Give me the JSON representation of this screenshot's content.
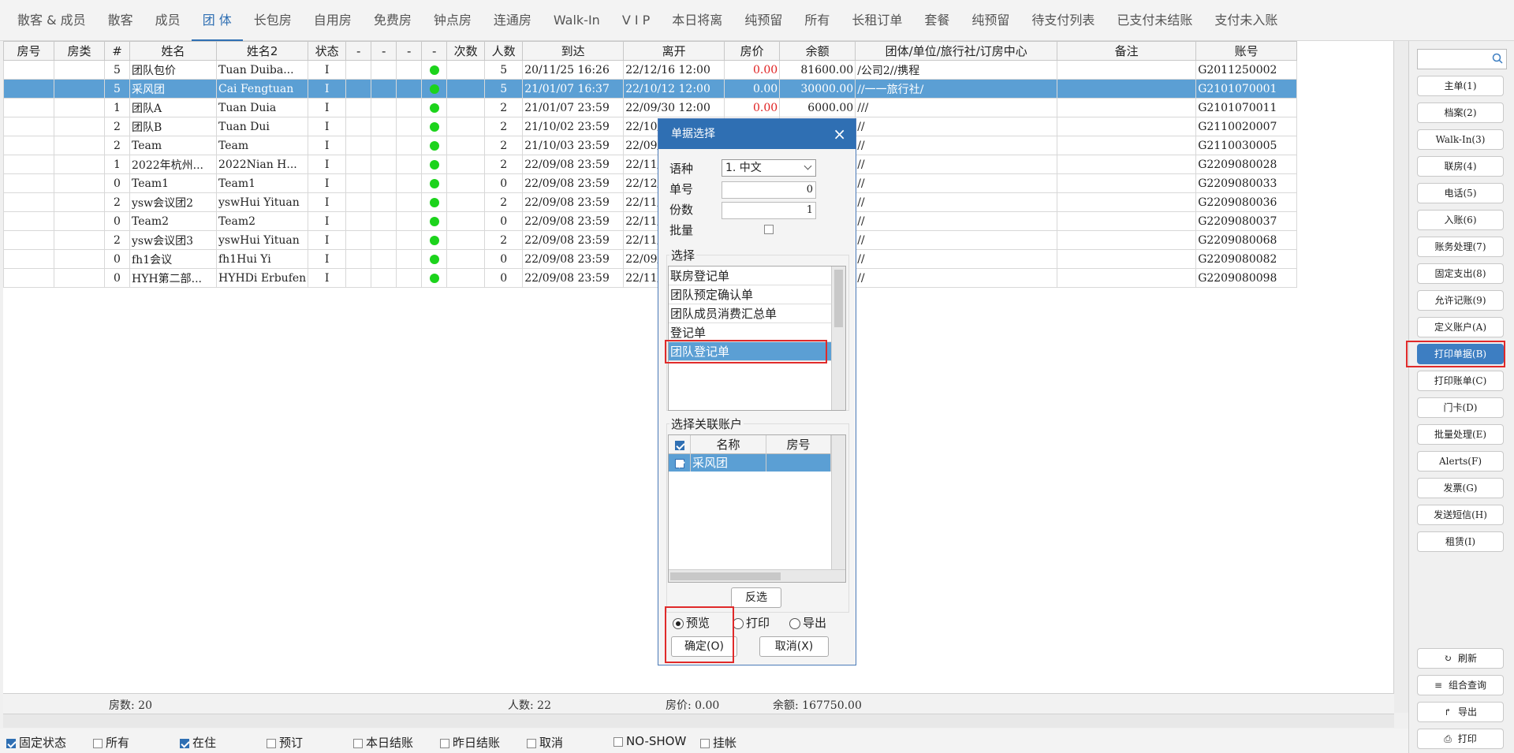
{
  "tabs": [
    {
      "label": "散客 & 成员",
      "active": false
    },
    {
      "label": "散客",
      "active": false
    },
    {
      "label": "成员",
      "active": false
    },
    {
      "label": "团 体",
      "active": true
    },
    {
      "label": "长包房",
      "active": false
    },
    {
      "label": "自用房",
      "active": false
    },
    {
      "label": "免费房",
      "active": false
    },
    {
      "label": "钟点房",
      "active": false
    },
    {
      "label": "连通房",
      "active": false
    },
    {
      "label": "Walk-In",
      "active": false
    },
    {
      "label": "V I P",
      "active": false
    },
    {
      "label": "本日将离",
      "active": false
    },
    {
      "label": "纯预留",
      "active": false
    },
    {
      "label": "所有",
      "active": false
    },
    {
      "label": "长租订单",
      "active": false
    },
    {
      "label": "套餐",
      "active": false
    },
    {
      "label": "纯预留",
      "active": false
    },
    {
      "label": "待支付列表",
      "active": false
    },
    {
      "label": "已支付未结账",
      "active": false
    },
    {
      "label": "支付未入账",
      "active": false
    }
  ],
  "grid": {
    "columns": [
      "房号",
      "房类",
      "#",
      "姓名",
      "姓名2",
      "状态",
      "-",
      "-",
      "-",
      "-",
      "次数",
      "人数",
      "到达",
      "离开",
      "房价",
      "余额",
      "团体/单位/旅行社/订房中心",
      "备注",
      "账号"
    ],
    "rows": [
      {
        "room": "",
        "type": "",
        "num": "5",
        "name": "团队包价",
        "name2": "Tuan Duiba...",
        "status": "I",
        "count": "",
        "persons": "5",
        "arrive": "20/11/25 16:26",
        "depart": "22/12/16 12:00",
        "price": "0.00",
        "balance": "81600.00",
        "group": "/公司2//携程",
        "remark": "",
        "account": "G2011250002",
        "selected": false
      },
      {
        "room": "",
        "type": "",
        "num": "5",
        "name": "采风团",
        "name2": "Cai Fengtuan",
        "status": "I",
        "count": "",
        "persons": "5",
        "arrive": "21/01/07 16:37",
        "depart": "22/10/12 12:00",
        "price": "0.00",
        "balance": "30000.00",
        "group": "//一一旅行社/",
        "remark": "",
        "account": "G2101070001",
        "selected": true
      },
      {
        "room": "",
        "type": "",
        "num": "1",
        "name": "团队A",
        "name2": "Tuan Duia",
        "status": "I",
        "count": "",
        "persons": "2",
        "arrive": "21/01/07 23:59",
        "depart": "22/09/30 12:00",
        "price": "0.00",
        "balance": "6000.00",
        "group": "///",
        "remark": "",
        "account": "G2101070011",
        "selected": false
      },
      {
        "room": "",
        "type": "",
        "num": "2",
        "name": "团队B",
        "name2": "Tuan Dui",
        "status": "I",
        "count": "",
        "persons": "2",
        "arrive": "21/10/02 23:59",
        "depart": "22/10/",
        "price": "",
        "balance": "",
        "group": "//",
        "remark": "",
        "account": "G2110020007",
        "selected": false
      },
      {
        "room": "",
        "type": "",
        "num": "2",
        "name": "Team",
        "name2": "Team",
        "status": "I",
        "count": "",
        "persons": "2",
        "arrive": "21/10/03 23:59",
        "depart": "22/09/",
        "price": "",
        "balance": "",
        "group": "//",
        "remark": "",
        "account": "G2110030005",
        "selected": false
      },
      {
        "room": "",
        "type": "",
        "num": "1",
        "name": "2022年杭州...",
        "name2": "2022Nian H...",
        "status": "I",
        "count": "",
        "persons": "2",
        "arrive": "22/09/08 23:59",
        "depart": "22/11/",
        "price": "",
        "balance": "",
        "group": "//",
        "remark": "",
        "account": "G2209080028",
        "selected": false
      },
      {
        "room": "",
        "type": "",
        "num": "0",
        "name": "Team1",
        "name2": "Team1",
        "status": "I",
        "count": "",
        "persons": "0",
        "arrive": "22/09/08 23:59",
        "depart": "22/12/",
        "price": "",
        "balance": "",
        "group": "//",
        "remark": "",
        "account": "G2209080033",
        "selected": false
      },
      {
        "room": "",
        "type": "",
        "num": "2",
        "name": "ysw会议团2",
        "name2": "yswHui Yituan",
        "status": "I",
        "count": "",
        "persons": "2",
        "arrive": "22/09/08 23:59",
        "depart": "22/11/",
        "price": "",
        "balance": "",
        "group": "//",
        "remark": "",
        "account": "G2209080036",
        "selected": false
      },
      {
        "room": "",
        "type": "",
        "num": "0",
        "name": "Team2",
        "name2": "Team2",
        "status": "I",
        "count": "",
        "persons": "0",
        "arrive": "22/09/08 23:59",
        "depart": "22/11/",
        "price": "",
        "balance": "",
        "group": "//",
        "remark": "",
        "account": "G2209080037",
        "selected": false
      },
      {
        "room": "",
        "type": "",
        "num": "2",
        "name": "ysw会议团3",
        "name2": "yswHui Yituan",
        "status": "I",
        "count": "",
        "persons": "2",
        "arrive": "22/09/08 23:59",
        "depart": "22/11/",
        "price": "",
        "balance": "",
        "group": "//",
        "remark": "",
        "account": "G2209080068",
        "selected": false
      },
      {
        "room": "",
        "type": "",
        "num": "0",
        "name": "fh1会议",
        "name2": "fh1Hui Yi",
        "status": "I",
        "count": "",
        "persons": "0",
        "arrive": "22/09/08 23:59",
        "depart": "22/09/",
        "price": "",
        "balance": "",
        "group": "//",
        "remark": "",
        "account": "G2209080082",
        "selected": false
      },
      {
        "room": "",
        "type": "",
        "num": "0",
        "name": "HYH第二部...",
        "name2": "HYHDi Erbufen",
        "status": "I",
        "count": "",
        "persons": "0",
        "arrive": "22/09/08 23:59",
        "depart": "22/11/",
        "price": "",
        "balance": "",
        "group": "//",
        "remark": "",
        "account": "G2209080098",
        "selected": false
      }
    ],
    "status_dot_color": "#1cd31c",
    "selected_color": "#5b9fd4"
  },
  "summary": {
    "rooms": "房数: 20",
    "persons": "人数: 22",
    "price": "房价: 0.00",
    "balance": "余额: 167750.00"
  },
  "footer": {
    "items": [
      {
        "label": "固定状态",
        "checked": true
      },
      {
        "label": "所有",
        "checked": false
      },
      {
        "label": "在住",
        "checked": true
      },
      {
        "label": "预订",
        "checked": false
      },
      {
        "label": "本日结账",
        "checked": false
      },
      {
        "label": "昨日结账",
        "checked": false
      },
      {
        "label": "取消",
        "checked": false
      },
      {
        "label": "NO-SHOW",
        "checked": false
      },
      {
        "label": "挂帐",
        "checked": false
      }
    ]
  },
  "sidebar": {
    "search_icon": "search-icon",
    "buttons": [
      {
        "label": "主单(1)",
        "active": false
      },
      {
        "label": "档案(2)",
        "active": false
      },
      {
        "label": "Walk-In(3)",
        "active": false
      },
      {
        "label": "联房(4)",
        "active": false
      },
      {
        "label": "电话(5)",
        "active": false
      },
      {
        "label": "入账(6)",
        "active": false
      },
      {
        "label": "账务处理(7)",
        "active": false
      },
      {
        "label": "固定支出(8)",
        "active": false
      },
      {
        "label": "允许记账(9)",
        "active": false
      },
      {
        "label": "定义账户(A)",
        "active": false
      },
      {
        "label": "打印单据(B)",
        "active": true
      },
      {
        "label": "打印账单(C)",
        "active": false
      },
      {
        "label": "门卡(D)",
        "active": false
      },
      {
        "label": "批量处理(E)",
        "active": false
      },
      {
        "label": "Alerts(F)",
        "active": false
      },
      {
        "label": "发票(G)",
        "active": false
      },
      {
        "label": "发送短信(H)",
        "active": false
      },
      {
        "label": "租赁(I)",
        "active": false
      }
    ],
    "bottom_buttons": [
      {
        "icon": "↻",
        "label": "刷新"
      },
      {
        "icon": "≡",
        "label": "组合查询"
      },
      {
        "icon": "↱",
        "label": "导出"
      },
      {
        "icon": "⎙",
        "label": "打印"
      }
    ],
    "accent": "#3d7ec2"
  },
  "dialog": {
    "title": "单据选择",
    "close": "×",
    "language_label": "语种",
    "language_value": "1. 中文",
    "number_label": "单号",
    "number_value": "0",
    "copies_label": "份数",
    "copies_value": "1",
    "batch_label": "批量",
    "select_label": "选择",
    "options": [
      {
        "label": "联房登记单",
        "selected": false
      },
      {
        "label": "团队预定确认单",
        "selected": false
      },
      {
        "label": "团队成员消费汇总单",
        "selected": false
      },
      {
        "label": "登记单",
        "selected": false
      },
      {
        "label": "团队登记单",
        "selected": true
      }
    ],
    "accounts_label": "选择关联账户",
    "accounts_columns": [
      "名称",
      "房号"
    ],
    "accounts_rows": [
      {
        "name": "采风团",
        "room": ""
      }
    ],
    "invert_label": "反选",
    "modes": [
      {
        "label": "预览",
        "checked": true
      },
      {
        "label": "打印",
        "checked": false
      },
      {
        "label": "导出",
        "checked": false
      }
    ],
    "ok_label": "确定(O)",
    "cancel_label": "取消(X)",
    "title_color": "#2f6fb3"
  }
}
